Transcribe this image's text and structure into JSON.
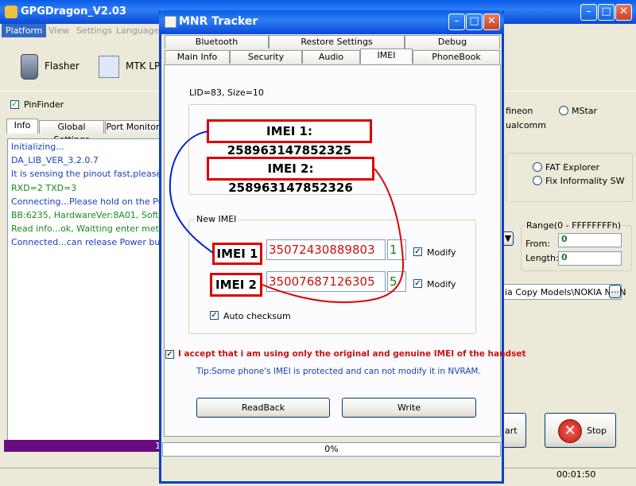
{
  "main_window": {
    "title": "GPGDragon_V2.03",
    "menu": [
      "Platform",
      "View",
      "Settings",
      "Languages"
    ],
    "toolbar": {
      "flasher": "Flasher",
      "mtk_lpe": "MTK LPE"
    },
    "pinfinder_label": "PinFinder",
    "tabs": [
      "Info",
      "Global Settings",
      "Port Monitor"
    ],
    "log_lines": [
      {
        "text": "Initializing...",
        "color": "#1a3fb8"
      },
      {
        "text": "DA_LIB_VER_3.2.0.7",
        "color": "#1a3fb8"
      },
      {
        "text": "It is sensing the pinout fast,please hold",
        "color": "#1a3fb8"
      },
      {
        "text": "RXD=2  TXD=3",
        "color": "#1a8a1a"
      },
      {
        "text": "Connecting...Please hold on the POWE",
        "color": "#1a3fb8"
      },
      {
        "text": "BB:6235,   HardwareVer:8A01,   Softw",
        "color": "#1a8a1a"
      },
      {
        "text": "Read info...ok, Waitting enter meta...",
        "color": "#1a8a1a"
      },
      {
        "text": "Connected...can release Power button",
        "color": "#1a3fb8"
      }
    ],
    "progress_text": "1",
    "radios": {
      "infineon": "fineon",
      "mstar": "MStar",
      "qualcomm": "ualcomm"
    },
    "options": {
      "fat_explorer": "FAT Explorer",
      "fix_informality": "Fix Informality SW"
    },
    "range": {
      "label": "Range(0 - FFFFFFFFh)",
      "from_label": "From:",
      "from_value": "0",
      "length_label": "Length:",
      "length_value": "0"
    },
    "model_path": "ia Copy Models\\NOKIA N8 N",
    "browse_label": "...",
    "start_label": "art",
    "stop_label": "Stop",
    "elapsed": "00:01:50"
  },
  "dialog": {
    "title": "MNR Tracker",
    "tabs_row1": [
      "Bluetooth",
      "Restore Settings",
      "Debug"
    ],
    "tabs_row2": [
      "Main Info",
      "Security",
      "Audio",
      "IMEI",
      "PhoneBook"
    ],
    "lid_info": "LID=83, Size=10",
    "current_imei1": "IMEI 1: 258963147852325",
    "current_imei2": "IMEI 2: 258963147852326",
    "new_imei_group": "New IMEI",
    "imei1_label": "IMEI 1",
    "imei1_value": "35072430889803",
    "imei1_checksum": "1",
    "imei2_label": "IMEI 2",
    "imei2_value": "35007687126305",
    "imei2_checksum": "5",
    "modify_label": "Modify",
    "auto_checksum": "Auto checksum",
    "accept_text": "I accept that i am using only the original and genuine IMEI of the handset",
    "tip": "Tip:Some phone's IMEI is protected and can not modify it in NVRAM.",
    "readback_label": "ReadBack",
    "write_label": "Write",
    "progress_text": "0%"
  },
  "colors": {
    "title_blue": "#0a5ce8",
    "annotation_red": "#dd0000",
    "annotation_blue": "#0022cc"
  }
}
